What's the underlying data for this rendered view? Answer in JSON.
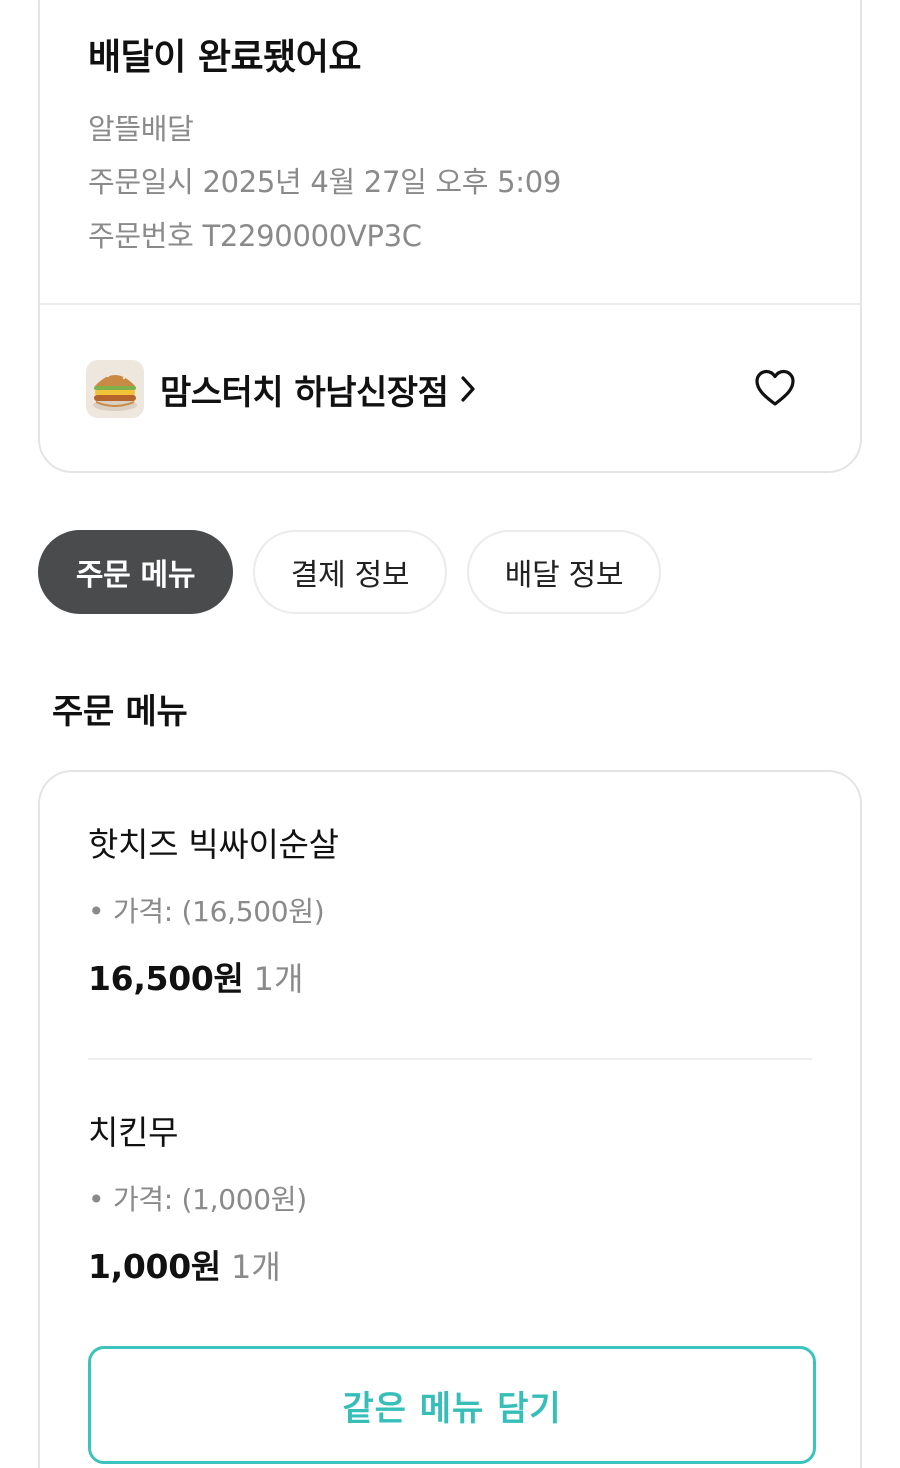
{
  "status": {
    "title": "배달이 완료됐어요",
    "delivery_type": "알뜰배달",
    "order_date": "주문일시 2025년 4월 27일 오후 5:09",
    "order_number": "주문번호 T2290000VP3C"
  },
  "store": {
    "name": "맘스터치 하남신장점",
    "thumb_icon": "burger-thumbnail",
    "chevron_icon": "chevron-right-icon",
    "favorite_icon": "heart-outline-icon"
  },
  "tabs": [
    {
      "label": "주문 메뉴",
      "active": true
    },
    {
      "label": "결제 정보",
      "active": false
    },
    {
      "label": "배달 정보",
      "active": false
    }
  ],
  "section": {
    "title": "주문 메뉴"
  },
  "items": [
    {
      "name": "핫치즈 빅싸이순살",
      "option": "• 가격: (16,500원)",
      "price": "16,500원",
      "qty": "1개"
    },
    {
      "name": "치킨무",
      "option": "• 가격: (1,000원)",
      "price": "1,000원",
      "qty": "1개"
    }
  ],
  "reorder": {
    "label": "같은 메뉴 담기"
  },
  "colors": {
    "accent": "#36bfb8",
    "tab_active_bg": "#4a4b4d",
    "muted_text": "#8a8a8a"
  }
}
